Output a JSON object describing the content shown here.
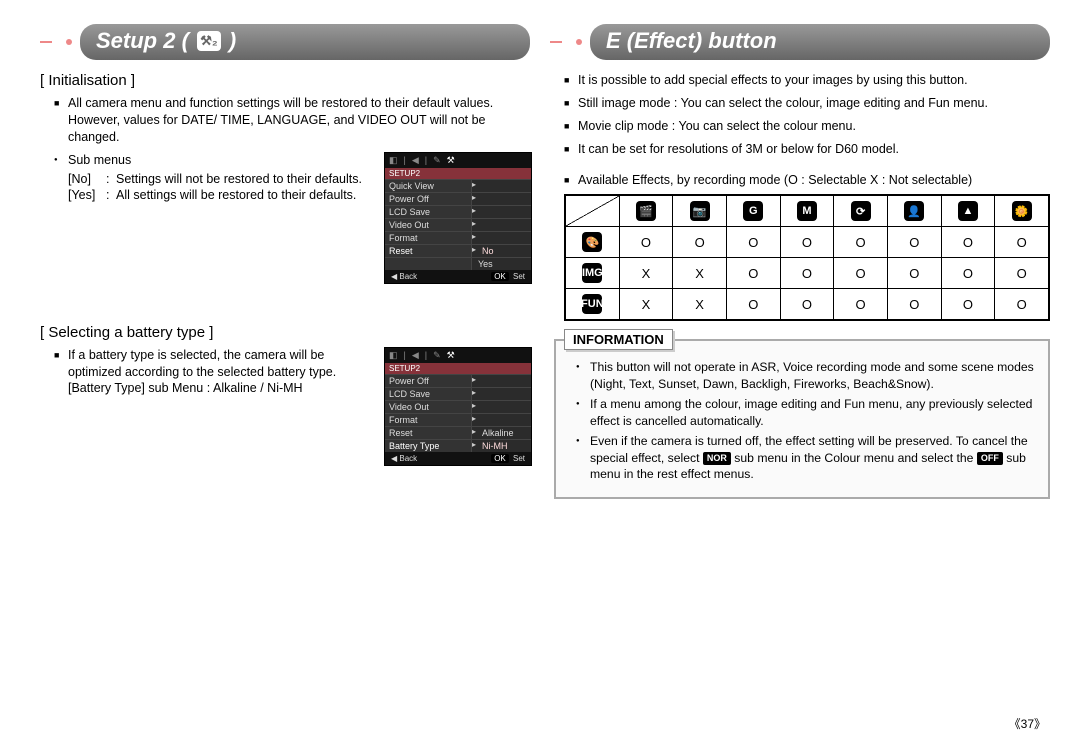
{
  "left": {
    "header": "Setup 2 (",
    "header_close": ")",
    "setup_badge": "⚒₂",
    "init_title": "[ Initialisation ]",
    "init_desc": "All camera menu and function settings will be restored to their default values. However, values for DATE/ TIME, LANGUAGE, and VIDEO OUT will not be changed.",
    "submenus_label": "Sub menus",
    "sub_no_key": "[No]",
    "sub_no_val": "Settings will not be restored to their defaults.",
    "sub_yes_key": "[Yes]",
    "sub_yes_val": "All settings will be restored to their defaults.",
    "lcd1": {
      "title": "SETUP2",
      "rows": [
        "Quick View",
        "Power Off",
        "LCD Save",
        "Video Out",
        "Format",
        "Reset"
      ],
      "vals": [
        "",
        "",
        "",
        "",
        "",
        "No",
        "Yes"
      ],
      "hl_val": "No",
      "alt_val": "Yes",
      "back": "Back",
      "set": "Set",
      "ok": "OK"
    },
    "batt_title": "[ Selecting a battery type ]",
    "batt_desc": "If a battery type is selected, the camera will be optimized according to the selected battery type. [Battery Type] sub Menu : Alkaline / Ni-MH",
    "lcd2": {
      "title": "SETUP2",
      "rows": [
        "Power Off",
        "LCD Save",
        "Video Out",
        "Format",
        "Reset",
        "Battery Type"
      ],
      "hl_val": "Alkaline",
      "alt_val": "Ni-MH",
      "back": "Back",
      "set": "Set",
      "ok": "OK"
    }
  },
  "right": {
    "header": "E (Effect) button",
    "bullets": [
      "It is possible to add special effects to your images by using this button.",
      "Still image mode : You can select the colour, image editing and Fun menu.",
      "Movie clip mode : You can select the colour menu.",
      "It can be set for resolutions of 3M or below for D60 model."
    ],
    "legend": "Available Effects, by recording mode (O : Selectable X : Not selectable)",
    "col_modes": [
      "🎬",
      "📷",
      "G",
      "M",
      "⟳",
      "👤",
      "▲",
      "🌼"
    ],
    "row_modes": [
      "🎨",
      "IMG",
      "FUN"
    ],
    "cells": [
      [
        "O",
        "O",
        "O",
        "O",
        "O",
        "O",
        "O",
        "O"
      ],
      [
        "X",
        "X",
        "O",
        "O",
        "O",
        "O",
        "O",
        "O"
      ],
      [
        "X",
        "X",
        "O",
        "O",
        "O",
        "O",
        "O",
        "O"
      ]
    ],
    "info_title": "INFORMATION",
    "info": [
      "This button will not operate in ASR, Voice recording mode and some scene modes (Night, Text, Sunset, Dawn, Backligh, Fireworks, Beach&Snow).",
      "If a menu among the colour, image editing and Fun menu, any previously selected effect is cancelled automatically.",
      "Even if the camera is turned off, the effect setting will be preserved. To cancel the special effect, select  NOR  sub menu in the Colour menu and select the  OFF  sub menu in the rest effect menus."
    ],
    "nor_chip": "NOR",
    "off_chip": "OFF"
  },
  "pageno": "《37》"
}
